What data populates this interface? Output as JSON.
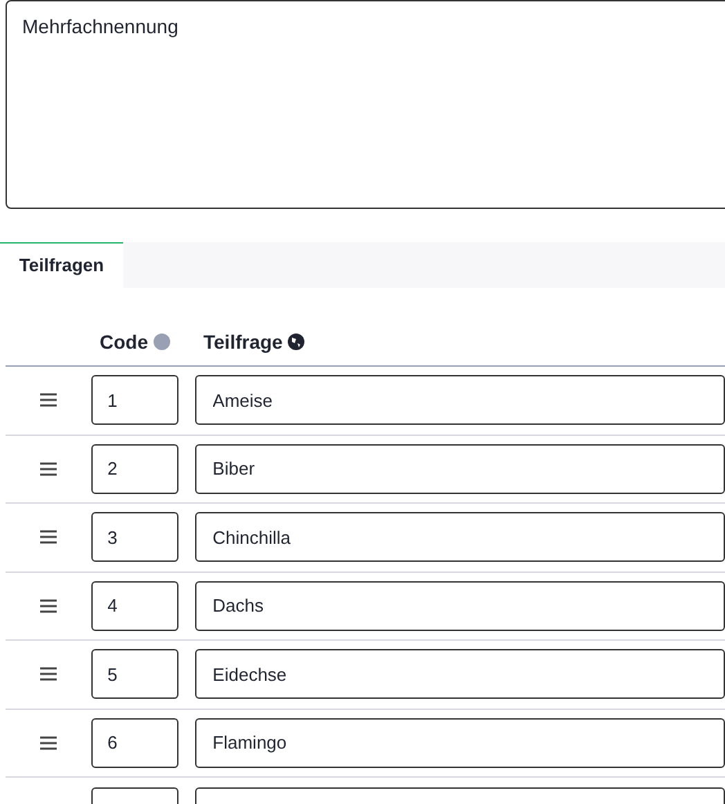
{
  "description_field": {
    "value": "Mehrfachnennung"
  },
  "tabs": [
    {
      "label": "Teilfragen",
      "selected": true
    }
  ],
  "table": {
    "columns": [
      "Code",
      "Teilfrage"
    ],
    "rows": [
      {
        "code": "1",
        "text": "Ameise"
      },
      {
        "code": "2",
        "text": "Biber"
      },
      {
        "code": "3",
        "text": "Chinchilla"
      },
      {
        "code": "4",
        "text": "Dachs"
      },
      {
        "code": "5",
        "text": "Eidechse"
      },
      {
        "code": "6",
        "text": "Flamingo"
      },
      {
        "partial": true
      }
    ]
  }
}
